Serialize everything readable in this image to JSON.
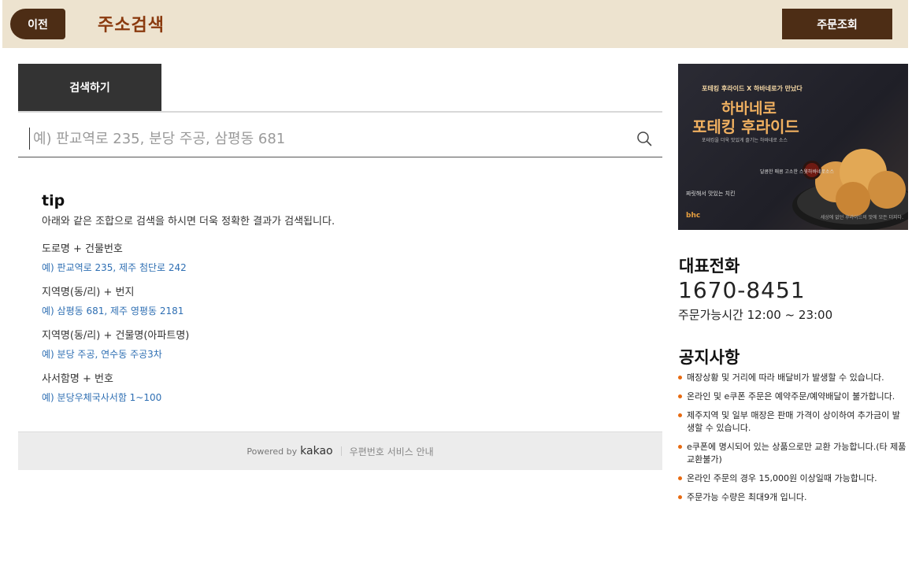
{
  "header": {
    "back_label": "이전",
    "title": "주소검색",
    "order_lookup_label": "주문조회"
  },
  "search": {
    "tab_label": "검색하기",
    "placeholder": "예) 판교역로 235, 분당 주공, 삼평동 681",
    "value": ""
  },
  "tip": {
    "title": "tip",
    "description": "아래와 같은 조합으로 검색을 하시면 더욱 정확한 결과가 검색됩니다.",
    "items": [
      {
        "heading": "도로명 + 건물번호",
        "example": "예) 판교역로 235,  제주 첨단로 242"
      },
      {
        "heading": "지역명(동/리) + 번지",
        "example": "예) 삼평동 681,  제주 영평동 2181"
      },
      {
        "heading": "지역명(동/리) + 건물명(아파트명)",
        "example": "예) 분당 주공,  연수동 주공3차"
      },
      {
        "heading": "사서함명 + 번호",
        "example": "예) 분당우체국사서함 1~100"
      }
    ]
  },
  "footer": {
    "powered_by": "Powered by",
    "brand": "kakao",
    "guide_link": "우편번호 서비스 안내"
  },
  "banner": {
    "subtitle": "포테킹 후라이드 X 하바네로가 만났다",
    "title_line1": "하바네로",
    "title_line2": "포테킹 후라이드",
    "description": "포테킹을 더욱 맛있게 즐기는 하바네로 소스",
    "corner_text": "짜릿해서 맛있는 치킨",
    "sauce_text": "달콤한 매콤 고소한 스윗하바네로소스",
    "logo": "bhc",
    "note": "세상에 없던 후라이드의 맛에 모든 더지다."
  },
  "contact": {
    "label": "대표전화",
    "phone": "1670-8451",
    "hours": "주문가능시간 12:00 ~ 23:00"
  },
  "notice": {
    "title": "공지사항",
    "items": [
      "매장상황 및 거리에 따라 배달비가 발생할 수 있습니다.",
      "온라인 및 e쿠폰 주문은 예약주문/예약배달이 불가합니다.",
      "제주지역 및 일부 매장은 판매 가격이 상이하여 추가금이 발생할 수 있습니다.",
      "e쿠폰에 명시되어 있는 상품으로만 교환 가능합니다.(타 제품 교환불가)",
      "온라인 주문의 경우 15,000원 이상일때 가능합니다.",
      "주문가능 수량은 최대9개 입니다."
    ]
  },
  "colors": {
    "header_bg": "#ede3cf",
    "brand_brown": "#4d2d15",
    "title_color": "#8a3a0e",
    "example_link": "#2f6fb3",
    "bullet": "#e86a10"
  }
}
